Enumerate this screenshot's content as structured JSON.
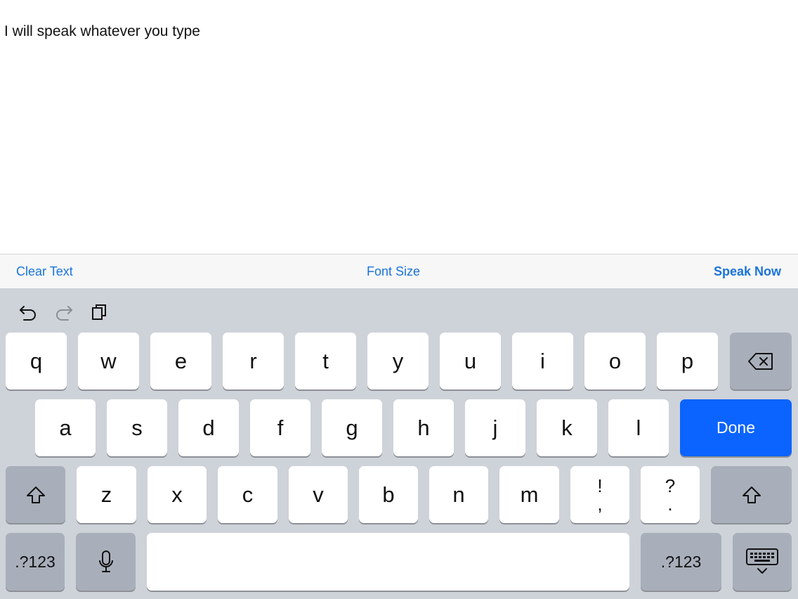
{
  "text_area": {
    "content": "I will speak whatever you type"
  },
  "toolbar": {
    "clear_label": "Clear Text",
    "font_size_label": "Font Size",
    "speak_label": "Speak Now"
  },
  "keyboard": {
    "row1": [
      "q",
      "w",
      "e",
      "r",
      "t",
      "y",
      "u",
      "i",
      "o",
      "p"
    ],
    "row2": [
      "a",
      "s",
      "d",
      "f",
      "g",
      "h",
      "j",
      "k",
      "l"
    ],
    "row3": [
      "z",
      "x",
      "c",
      "v",
      "b",
      "n",
      "m"
    ],
    "done_label": "Done",
    "punct1_top": "!",
    "punct1_bottom": ",",
    "punct2_top": "?",
    "punct2_bottom": ".",
    "numbers_label": ".?123",
    "icons": {
      "undo": "undo-icon",
      "redo": "redo-icon",
      "paste": "paste-icon",
      "delete": "backspace-icon",
      "shift": "shift-icon",
      "mic": "microphone-icon",
      "dismiss": "keyboard-dismiss-icon"
    },
    "colors": {
      "background": "#ced2d9",
      "key": "#ffffff",
      "dark_key": "#a9afba",
      "done": "#0b64ff",
      "accent": "#1a73d9"
    }
  }
}
